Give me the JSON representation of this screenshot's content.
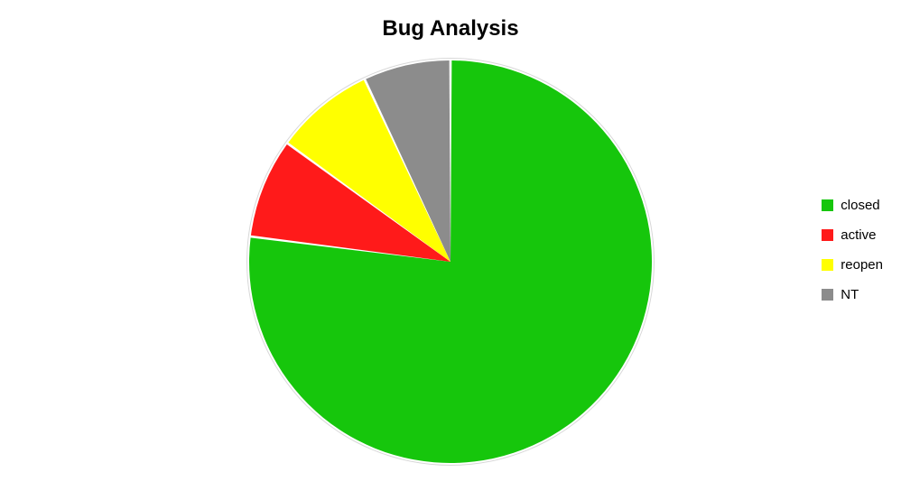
{
  "chart_data": {
    "type": "pie",
    "title": "Bug Analysis",
    "series": [
      {
        "name": "closed",
        "value": 77,
        "color": "#16c60c"
      },
      {
        "name": "active",
        "value": 8,
        "color": "#ff1a1a"
      },
      {
        "name": "reopen",
        "value": 8,
        "color": "#ffff00"
      },
      {
        "name": "NT",
        "value": 7,
        "color": "#8c8c8c"
      }
    ],
    "legend_position": "right"
  }
}
